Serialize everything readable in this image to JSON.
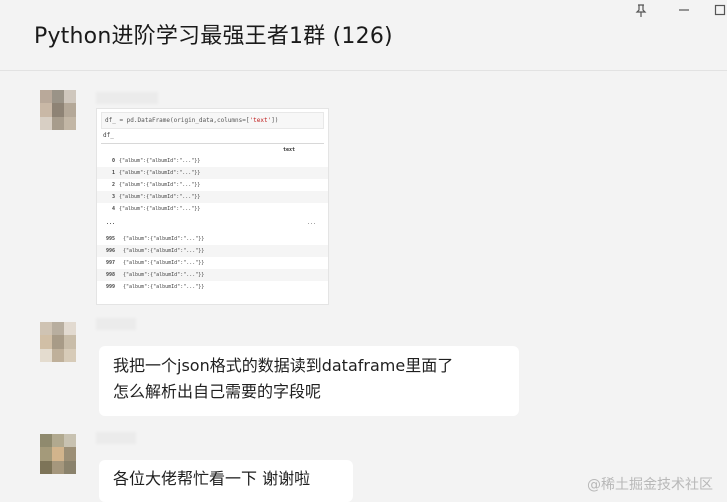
{
  "window": {
    "title": "Python进阶学习最强王者1群 (126)",
    "controls": {
      "pin_icon": "pin-icon",
      "minimize": "−",
      "maximize": "□"
    }
  },
  "messages": [
    {
      "type": "image",
      "image": {
        "code_prefix": "df_ = pd.DataFrame(origin_data,columns=[",
        "code_keyword": "'text'",
        "code_suffix": "])",
        "output_var": "df_",
        "column_header": "text",
        "rows_top": [
          {
            "index": "0",
            "value": "{\"album\":{\"albumId\":\"...\"}}"
          },
          {
            "index": "1",
            "value": "{\"album\":{\"albumId\":\"...\"}}"
          },
          {
            "index": "2",
            "value": "{\"album\":{\"albumId\":\"...\"}}"
          },
          {
            "index": "3",
            "value": "{\"album\":{\"albumId\":\"...\"}}"
          },
          {
            "index": "4",
            "value": "{\"album\":{\"albumId\":\"...\"}}"
          }
        ],
        "ellipsis": "...",
        "rows_bottom": [
          {
            "index": "995",
            "value": "{\"album\":{\"albumId\":\"...\"}}"
          },
          {
            "index": "996",
            "value": "{\"album\":{\"albumId\":\"...\"}}"
          },
          {
            "index": "997",
            "value": "{\"album\":{\"albumId\":\"...\"}}"
          },
          {
            "index": "998",
            "value": "{\"album\":{\"albumId\":\"...\"}}"
          },
          {
            "index": "999",
            "value": "{\"album\":{\"albumId\":\"...\"}}"
          }
        ]
      }
    },
    {
      "type": "text",
      "lines": [
        "我把一个json格式的数据读到dataframe里面了",
        "怎么解析出自己需要的字段呢"
      ]
    },
    {
      "type": "text",
      "lines": [
        "各位大佬帮忙看一下  谢谢啦"
      ]
    }
  ],
  "watermark": "@稀土掘金技术社区",
  "colors": {
    "background": "#f3f3f3",
    "bubble": "#ffffff",
    "text": "#1f1f1f"
  }
}
